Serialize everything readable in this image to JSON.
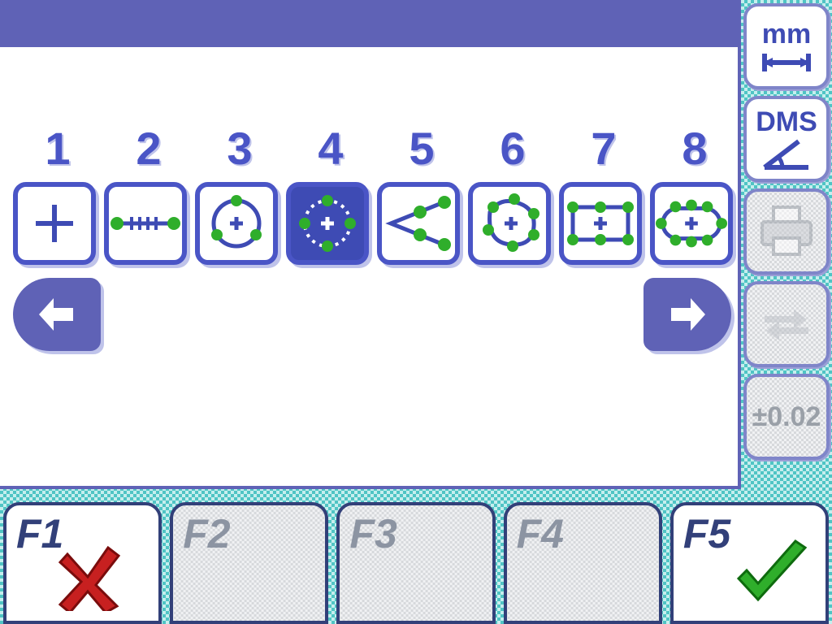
{
  "measure": {
    "labels": [
      "1",
      "2",
      "3",
      "4",
      "5",
      "6",
      "7",
      "8"
    ],
    "selected_index": 3,
    "items": [
      {
        "name": "measure-point"
      },
      {
        "name": "measure-line"
      },
      {
        "name": "measure-circle"
      },
      {
        "name": "measure-arc"
      },
      {
        "name": "measure-angle"
      },
      {
        "name": "measure-blob"
      },
      {
        "name": "measure-rectangle"
      },
      {
        "name": "measure-slot"
      }
    ]
  },
  "nav": {
    "left_name": "page-left",
    "right_name": "page-right"
  },
  "sidebar": {
    "unit_label": "mm",
    "angle_label": "DMS",
    "tolerance_label": "±0.02"
  },
  "fkeys": {
    "f1": "F1",
    "f2": "F2",
    "f3": "F3",
    "f4": "F4",
    "f5": "F5"
  },
  "colors": {
    "accent": "#4a55c6",
    "accent_dark": "#3e4bb4",
    "green": "#2fae2b",
    "green_dot": "#2fae2b",
    "red": "#c72020"
  }
}
